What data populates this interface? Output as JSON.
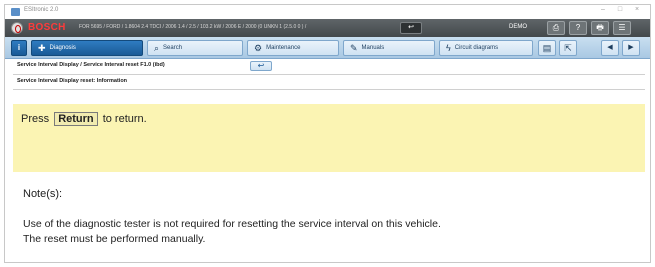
{
  "window": {
    "title": "ESItronic 2.0",
    "controls": [
      "–",
      "□",
      "×"
    ]
  },
  "header": {
    "brand": "BOSCH",
    "vehicle": "FOR 5695 / FORD / 1.8604 2.4 TDCI / 2006 1.4 / 2.5 / 103.2 kW / 2006 E / 2000 (0 UNKN 1 (2.5.0 0 ) /",
    "back_arrow": "↩",
    "mode": "DEMO",
    "icons": {
      "print": "⎙",
      "help": "?",
      "printer": "🖶",
      "menu": "☰"
    }
  },
  "tabs": {
    "info_label": "i",
    "items": [
      {
        "label": "Diagnosis",
        "icon": "stethoscope-icon",
        "glyph": "✚"
      },
      {
        "label": "Search",
        "icon": "search-icon",
        "glyph": "⌕"
      },
      {
        "label": "Maintenance",
        "icon": "gears-icon",
        "glyph": "⚙"
      },
      {
        "label": "Manuals",
        "icon": "wrench-icon",
        "glyph": "✎"
      },
      {
        "label": "Circuit diagrams",
        "icon": "circuit-icon",
        "glyph": "ϟ"
      }
    ],
    "tool_icons": [
      {
        "name": "document-icon",
        "glyph": "▤"
      },
      {
        "name": "external-icon",
        "glyph": "⇱"
      }
    ],
    "nav": {
      "prev": "◀",
      "next": "▶"
    }
  },
  "breadcrumb": {
    "path": "Service Interval Display / Service Interval reset F1.0 (ibd)",
    "back_glyph": "↩"
  },
  "subtitle": "Service Interval Display reset: Information",
  "message": {
    "prefix": "Press",
    "key": "Return",
    "suffix": "to return."
  },
  "notes": {
    "label": "Note(s):",
    "lines": [
      "Use of the diagnostic tester is not required for resetting the service interval on this vehicle.",
      "The reset must be performed manually."
    ]
  },
  "colors": {
    "header_bg": "#4f5558",
    "brand_red": "#ff3b3b",
    "tab_active": "#1f67a8",
    "message_bg": "#fbf4b3"
  }
}
